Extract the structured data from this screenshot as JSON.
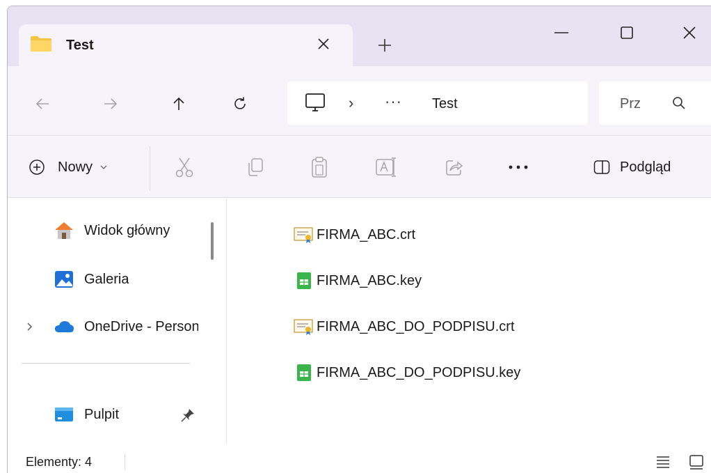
{
  "tab": {
    "title": "Test"
  },
  "address": {
    "current": "Test",
    "separator": "›",
    "more": "···"
  },
  "search": {
    "placeholder": "Przeszukaj: Test",
    "visible_text": "Prz"
  },
  "commands": {
    "new_label": "Nowy",
    "preview_label": "Podgląd",
    "more": "···"
  },
  "sidebar": {
    "items": [
      {
        "label": "Widok główny"
      },
      {
        "label": "Galeria"
      },
      {
        "label": "OneDrive - Personal"
      },
      {
        "label": "Pulpit"
      }
    ]
  },
  "files": [
    {
      "name": "FIRMA_ABC.crt",
      "type": "certificate"
    },
    {
      "name": "FIRMA_ABC.key",
      "type": "key"
    },
    {
      "name": "FIRMA_ABC_DO_PODPISU.crt",
      "type": "certificate"
    },
    {
      "name": "FIRMA_ABC_DO_PODPISU.key",
      "type": "key"
    }
  ],
  "status": {
    "text": "Elementy: 4"
  },
  "colors": {
    "titlebar": "#e9e2f2",
    "panel": "#f7f3fb",
    "folder": "#f4c542",
    "onedrive": "#1e7ad8",
    "key_green": "#3ab54a"
  }
}
